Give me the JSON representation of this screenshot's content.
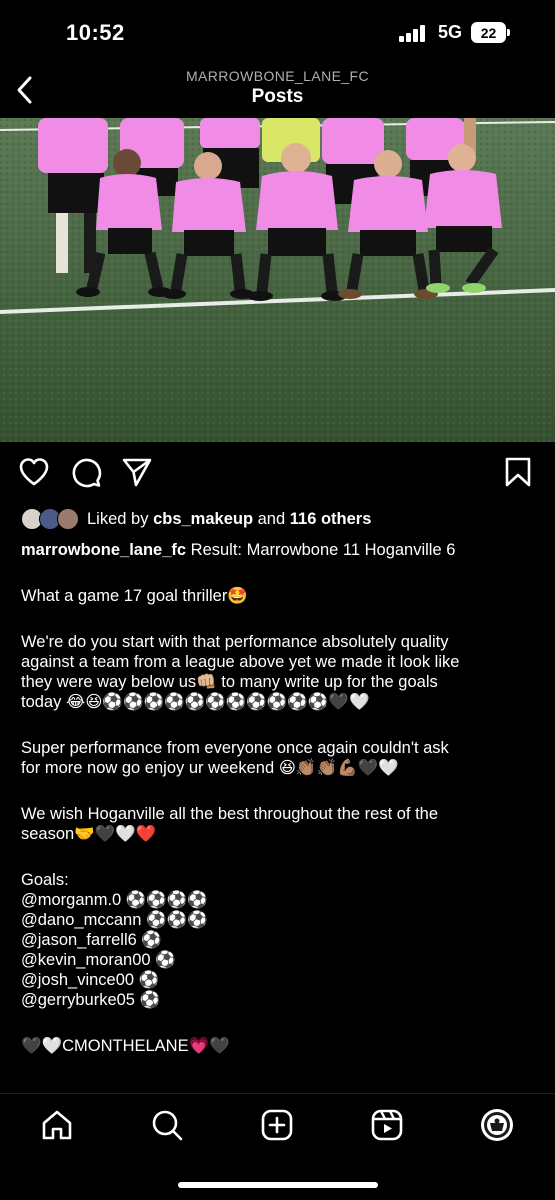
{
  "status_bar": {
    "time": "10:52",
    "network": "5G",
    "battery": "22"
  },
  "header": {
    "account": "MARROWBONE_LANE_FC",
    "title": "Posts"
  },
  "post": {
    "liked_by_prefix": "Liked by",
    "liked_by_user": "cbs_makeup",
    "liked_by_and": "and",
    "liked_by_others": "116 others",
    "username": "marrowbone_lane_fc",
    "caption_first": "Result: Marrowbone 11 Hoganville 6",
    "caption_lines": [
      "What a game 17 goal thriller🤩",
      "We're do you start with that performance absolutely quality",
      "against a team from a league above yet we made it look like",
      "they were way below us👊🏼 to many write up for the goals",
      "today 😂😆⚽⚽⚽⚽⚽⚽⚽⚽⚽⚽⚽🖤🤍",
      "Super performance from everyone once again couldn't ask",
      "for more now go enjoy ur weekend 😆👏🏽👏🏽💪🏽🖤🤍",
      "We wish Hoganville all the best throughout the rest of the",
      "season🤝🖤🤍❤️",
      "Goals:",
      "@morganm.0 ⚽⚽⚽⚽",
      "@dano_mccann ⚽⚽⚽",
      "@jason_farrell6 ⚽",
      "@kevin_moran00 ⚽",
      "@josh_vince00 ⚽",
      "@gerryburke05 ⚽",
      "🖤🤍CMONTHELANE💗🖤"
    ]
  },
  "icons": {
    "back": "chevron-left-icon",
    "like": "heart-icon",
    "comment": "comment-icon",
    "share": "paper-plane-icon",
    "save": "bookmark-icon",
    "home": "home-icon",
    "search": "search-icon",
    "create": "plus-square-icon",
    "reels": "reels-icon",
    "profile": "profile-avatar"
  },
  "colors": {
    "background": "#000000",
    "kit_pink": "#f08ce6",
    "pitch": "#3f5e3a"
  }
}
